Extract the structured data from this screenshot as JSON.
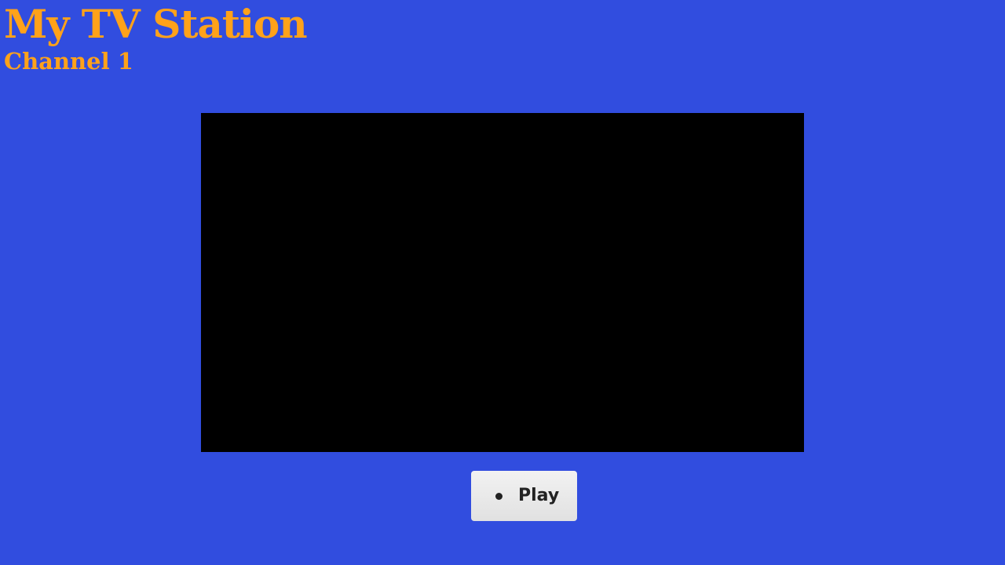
{
  "header": {
    "title": "My TV Station",
    "channel": "Channel 1"
  },
  "player": {
    "play_label": "Play"
  },
  "colors": {
    "background": "#314ddf",
    "title_accent": "#ffa21a",
    "screen": "#000000",
    "button_face": "#ececec",
    "button_text": "#222222"
  },
  "icons": {
    "play_bullet": "bullet-icon"
  }
}
